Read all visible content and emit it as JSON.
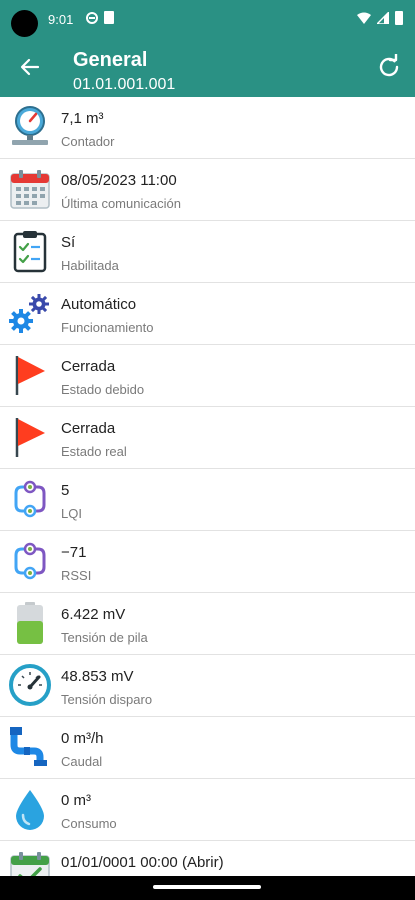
{
  "status": {
    "time": "9:01"
  },
  "header": {
    "title": "General",
    "subtitle": "01.01.001.001"
  },
  "items": [
    {
      "icon": "meter-gauge-icon",
      "value": "7,1 m³",
      "label": "Contador"
    },
    {
      "icon": "calendar-icon",
      "value": "08/05/2023 11:00",
      "label": "Última comunicación"
    },
    {
      "icon": "clipboard-check-icon",
      "value": "Sí",
      "label": "Habilitada"
    },
    {
      "icon": "gears-icon",
      "value": "Automático",
      "label": "Funcionamiento"
    },
    {
      "icon": "red-flag-icon",
      "value": "Cerrada",
      "label": "Estado debido"
    },
    {
      "icon": "red-flag-icon",
      "value": "Cerrada",
      "label": "Estado real"
    },
    {
      "icon": "link-quality-icon",
      "value": "5",
      "label": "LQI"
    },
    {
      "icon": "signal-strength-icon",
      "value": "−71",
      "label": "RSSI"
    },
    {
      "icon": "battery-icon",
      "value": "6.422 mV",
      "label": "Tensión de pila"
    },
    {
      "icon": "voltage-gauge-icon",
      "value": "48.853 mV",
      "label": "Tensión disparo"
    },
    {
      "icon": "pipe-flow-icon",
      "value": "0 m³/h",
      "label": "Caudal"
    },
    {
      "icon": "water-drop-icon",
      "value": "0 m³",
      "label": "Consumo"
    },
    {
      "icon": "calendar-check-icon",
      "value": "01/01/0001 00:00 (Abrir)",
      "label": ""
    }
  ]
}
